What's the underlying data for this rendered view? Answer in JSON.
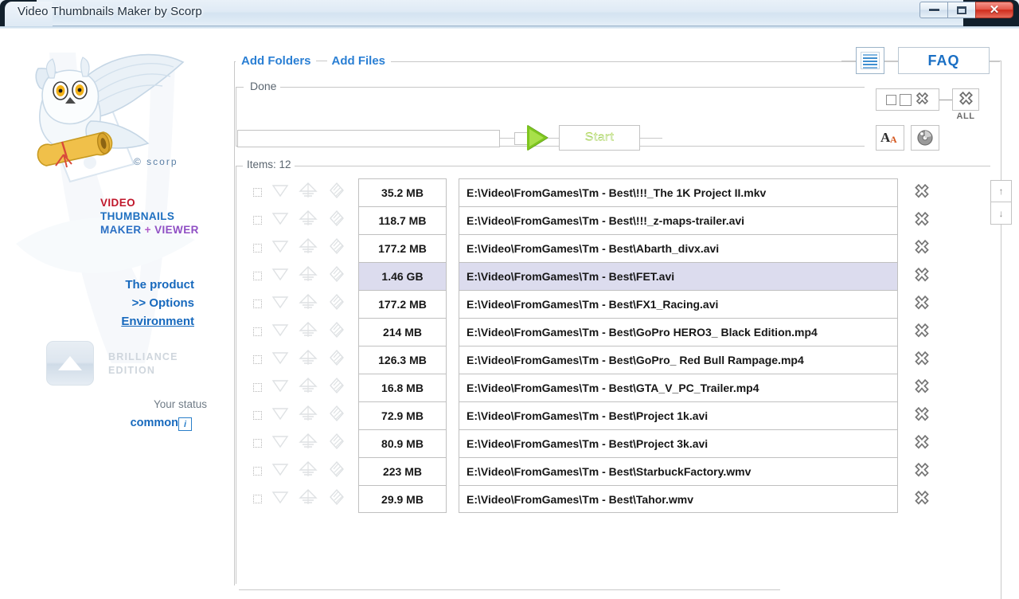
{
  "window": {
    "title": "Video Thumbnails Maker by Scorp",
    "minimize_label": "–",
    "maximize_label": "□",
    "close_label": "✕"
  },
  "sidebar": {
    "copyright": "© scorp",
    "brand": {
      "line1": "VIDEO",
      "line2": "THUMBNAILS",
      "line3_a": "MAKER",
      "line3_plus": " + ",
      "line3_b": "VIEWER"
    },
    "links": [
      {
        "label": "The product"
      },
      {
        "label": ">> Options"
      },
      {
        "label": "Environment"
      }
    ],
    "edition": {
      "line1": "BRILLIANCE",
      "line2": "EDITION"
    },
    "status_label": "Your status",
    "status_value": "common",
    "info_glyph": "i"
  },
  "toolbar": {
    "add_folders": "Add Folders",
    "add_files": "Add Files",
    "done_label": "Done",
    "progress_value": "",
    "progress_placeholder": "",
    "start_label": "Start",
    "faq_label": "FAQ",
    "list_icon": "list-view-icon",
    "delete_selected_icon": "delete-selected-icon",
    "delete_all_icon": "delete-all-icon",
    "delete_all_label": "ALL",
    "font_icon": "font-settings-icon",
    "disc_icon": "disc-burn-icon",
    "play_icon": "play-triangle-icon"
  },
  "list": {
    "items_label": "Items: 12",
    "count": 12,
    "selected_index": 3,
    "move_up_label": "↑",
    "move_down_label": "↓",
    "row_delete_icon": "delete-row-icon",
    "rows": [
      {
        "size": "35.2 MB",
        "path": "E:\\Video\\FromGames\\Tm - Best\\!!!_The 1K Project II.mkv"
      },
      {
        "size": "118.7 MB",
        "path": "E:\\Video\\FromGames\\Tm - Best\\!!!_z-maps-trailer.avi"
      },
      {
        "size": "177.2 MB",
        "path": "E:\\Video\\FromGames\\Tm - Best\\Abarth_divx.avi"
      },
      {
        "size": "1.46 GB",
        "path": "E:\\Video\\FromGames\\Tm - Best\\FET.avi"
      },
      {
        "size": "177.2 MB",
        "path": "E:\\Video\\FromGames\\Tm - Best\\FX1_Racing.avi"
      },
      {
        "size": "214 MB",
        "path": "E:\\Video\\FromGames\\Tm - Best\\GoPro HERO3_ Black Edition.mp4"
      },
      {
        "size": "126.3 MB",
        "path": "E:\\Video\\FromGames\\Tm - Best\\GoPro_ Red Bull Rampage.mp4"
      },
      {
        "size": "16.8 MB",
        "path": "E:\\Video\\FromGames\\Tm - Best\\GTA_V_PC_Trailer.mp4"
      },
      {
        "size": "72.9 MB",
        "path": "E:\\Video\\FromGames\\Tm - Best\\Project 1k.avi"
      },
      {
        "size": "80.9 MB",
        "path": "E:\\Video\\FromGames\\Tm - Best\\Project 3k.avi"
      },
      {
        "size": "223 MB",
        "path": "E:\\Video\\FromGames\\Tm - Best\\StarbuckFactory.wmv"
      },
      {
        "size": "29.9 MB",
        "path": "E:\\Video\\FromGames\\Tm - Best\\Tahor.wmv"
      }
    ]
  },
  "colors": {
    "accent_blue": "#1769bd",
    "link_blue": "#2a7fd4",
    "brand_red": "#c0172b",
    "brand_purple": "#8f4fc4",
    "start_green": "#8cc63f",
    "selection": "#dcdcee",
    "titlebar_close": "#cf2c1c"
  }
}
